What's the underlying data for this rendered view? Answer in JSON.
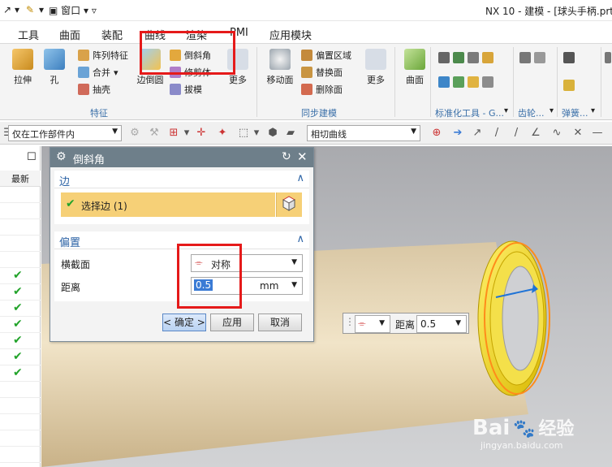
{
  "title_bar": {
    "window_menu": "窗口",
    "title": "NX 10 - 建模 - [球头手柄.prt]"
  },
  "menu_tabs": [
    "工具",
    "曲面",
    "装配",
    "曲线",
    "渲染",
    "PMI",
    "应用模块"
  ],
  "ribbon": {
    "feature_group": {
      "extrude": "拉伸",
      "hole": "孔",
      "pattern_feature": "阵列特征",
      "unite": "合并",
      "shell": "抽壳",
      "edge_blend": "边倒圆",
      "chamfer": "倒斜角",
      "trim_body": "修剪体",
      "draft": "拔模",
      "more": "更多",
      "label": "特征"
    },
    "sync_group": {
      "move_face": "移动面",
      "offset_region": "偏置区域",
      "replace_face": "替换面",
      "delete_face": "删除面",
      "more": "更多",
      "label": "同步建模"
    },
    "surface_group": {
      "surface": "曲面"
    },
    "standard_tools_label": "标准化工具 - G...",
    "gear_label": "齿轮...",
    "spring_label": "弹簧..."
  },
  "selection_bar": {
    "scope": "仅在工作部件内",
    "curve_rule": "相切曲线"
  },
  "navigator": {
    "column_header": "最新",
    "checked_rows": 7
  },
  "dialog": {
    "title": "倒斜角",
    "edge_section": "边",
    "select_edge": "选择边 (1)",
    "offset_section": "偏置",
    "cross_section_label": "横截面",
    "cross_section_value": "对称",
    "distance_label": "距离",
    "distance_value": "0.5",
    "distance_unit": "mm",
    "ok": "< 确定 >",
    "apply": "应用",
    "cancel": "取消"
  },
  "float_bar": {
    "distance_label": "距离",
    "distance_value": "0.5"
  },
  "watermark": {
    "brand": "Bai",
    "brand_cn": "经验",
    "url": "jingyan.baidu.com"
  },
  "colors": {
    "accent": "#2b62a5",
    "highlight": "#e51a1a",
    "selected_row": "#f6d077",
    "edge_ring": "#f2d20e",
    "check": "#22a32a"
  }
}
